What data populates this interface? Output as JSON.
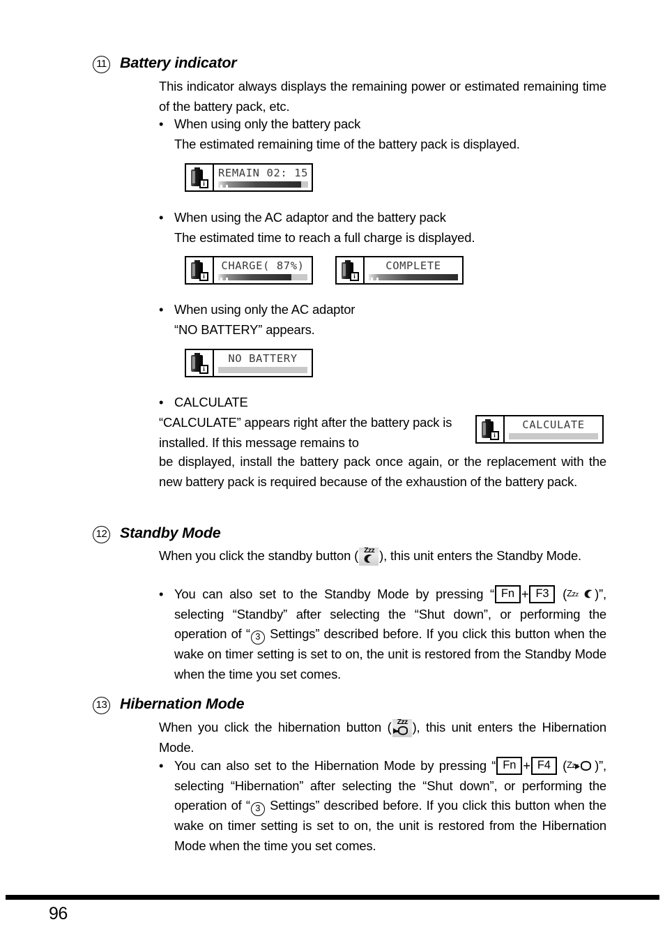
{
  "document": {
    "page_number": "96"
  },
  "sections": [
    {
      "marker": "11",
      "title": "Battery indicator",
      "intro": "This indicator always displays the remaining power or estimated remaining time of the battery pack, etc.",
      "bullets": [
        {
          "head": "When using only the battery pack",
          "sub": "The estimated remaining time of the battery pack is displayed."
        },
        {
          "head": "When using the AC adaptor and the battery pack",
          "sub": "The estimated time to reach a full charge is displayed."
        },
        {
          "head": "When using only the AC adaptor",
          "sub": "“NO BATTERY” appears."
        },
        {
          "head": "CALCULATE",
          "sub_part1": "“CALCULATE” appears right after the battery pack is installed. If this message remains to",
          "sub_part2": "be displayed, install the battery pack once again, or the replacement with the new battery pack is required because of the exhaustion of the battery pack."
        }
      ]
    },
    {
      "marker": "12",
      "title": "Standby Mode",
      "intro_before_icon": "When you click the standby button (",
      "intro_after_icon": "), this unit enters the Standby Mode.",
      "bullet": {
        "part1": "You can also set to the Standby Mode by pressing “",
        "key1": "Fn",
        "plus": "+",
        "key2": "F3",
        "part2": "”, selecting “Standby” after selecting the “Shut down”, or performing the operation of “",
        "circled_ref": "3",
        "part3": " Settings” described before. If you click this button when the wake on timer setting is set to on, the unit is restored from the Standby Mode when the time you set comes."
      }
    },
    {
      "marker": "13",
      "title": "Hibernation Mode",
      "intro_before_icon": "When you click the hibernation button (",
      "intro_after_icon": "), this unit enters the Hibernation Mode.",
      "bullet": {
        "part1": "You can also set to the Hibernation Mode by pressing “",
        "key1": "Fn",
        "plus": "+",
        "key2": "F4",
        "part2": "”, selecting “Hibernation” after selecting the “Shut down”, or performing the operation of “",
        "circled_ref": "3",
        "part3": " Settings” described before. If you click this button when the wake on timer setting is set to on, the unit is restored from the Hibernation Mode when the time you set comes."
      }
    }
  ],
  "lcd_displays": {
    "remain": {
      "text": "REMAIN 02: 15",
      "bar_fill_percent": 92,
      "icon": "battery-info-icon"
    },
    "charge": {
      "text": "CHARGE( 87%)",
      "bar_fill_percent": 82,
      "icon": "battery-info-icon"
    },
    "complete": {
      "text": "COMPLETE",
      "bar_fill_percent": 100,
      "icon": "battery-info-icon"
    },
    "no_battery": {
      "text": "NO BATTERY",
      "bar_fill_percent": 0,
      "icon": "battery-info-icon"
    },
    "calculate": {
      "text": "CALCULATE",
      "bar_fill_percent": 0,
      "icon": "battery-info-icon"
    }
  },
  "icons": {
    "standby_zzz": "Zzz",
    "hibernation_zzz": "Zzz",
    "battery_badge": "i"
  },
  "colors": {
    "ink": "#000000",
    "paper": "#ffffff",
    "lcd_text": "#3a3a3a",
    "bar_empty": "#c9c9c9"
  }
}
